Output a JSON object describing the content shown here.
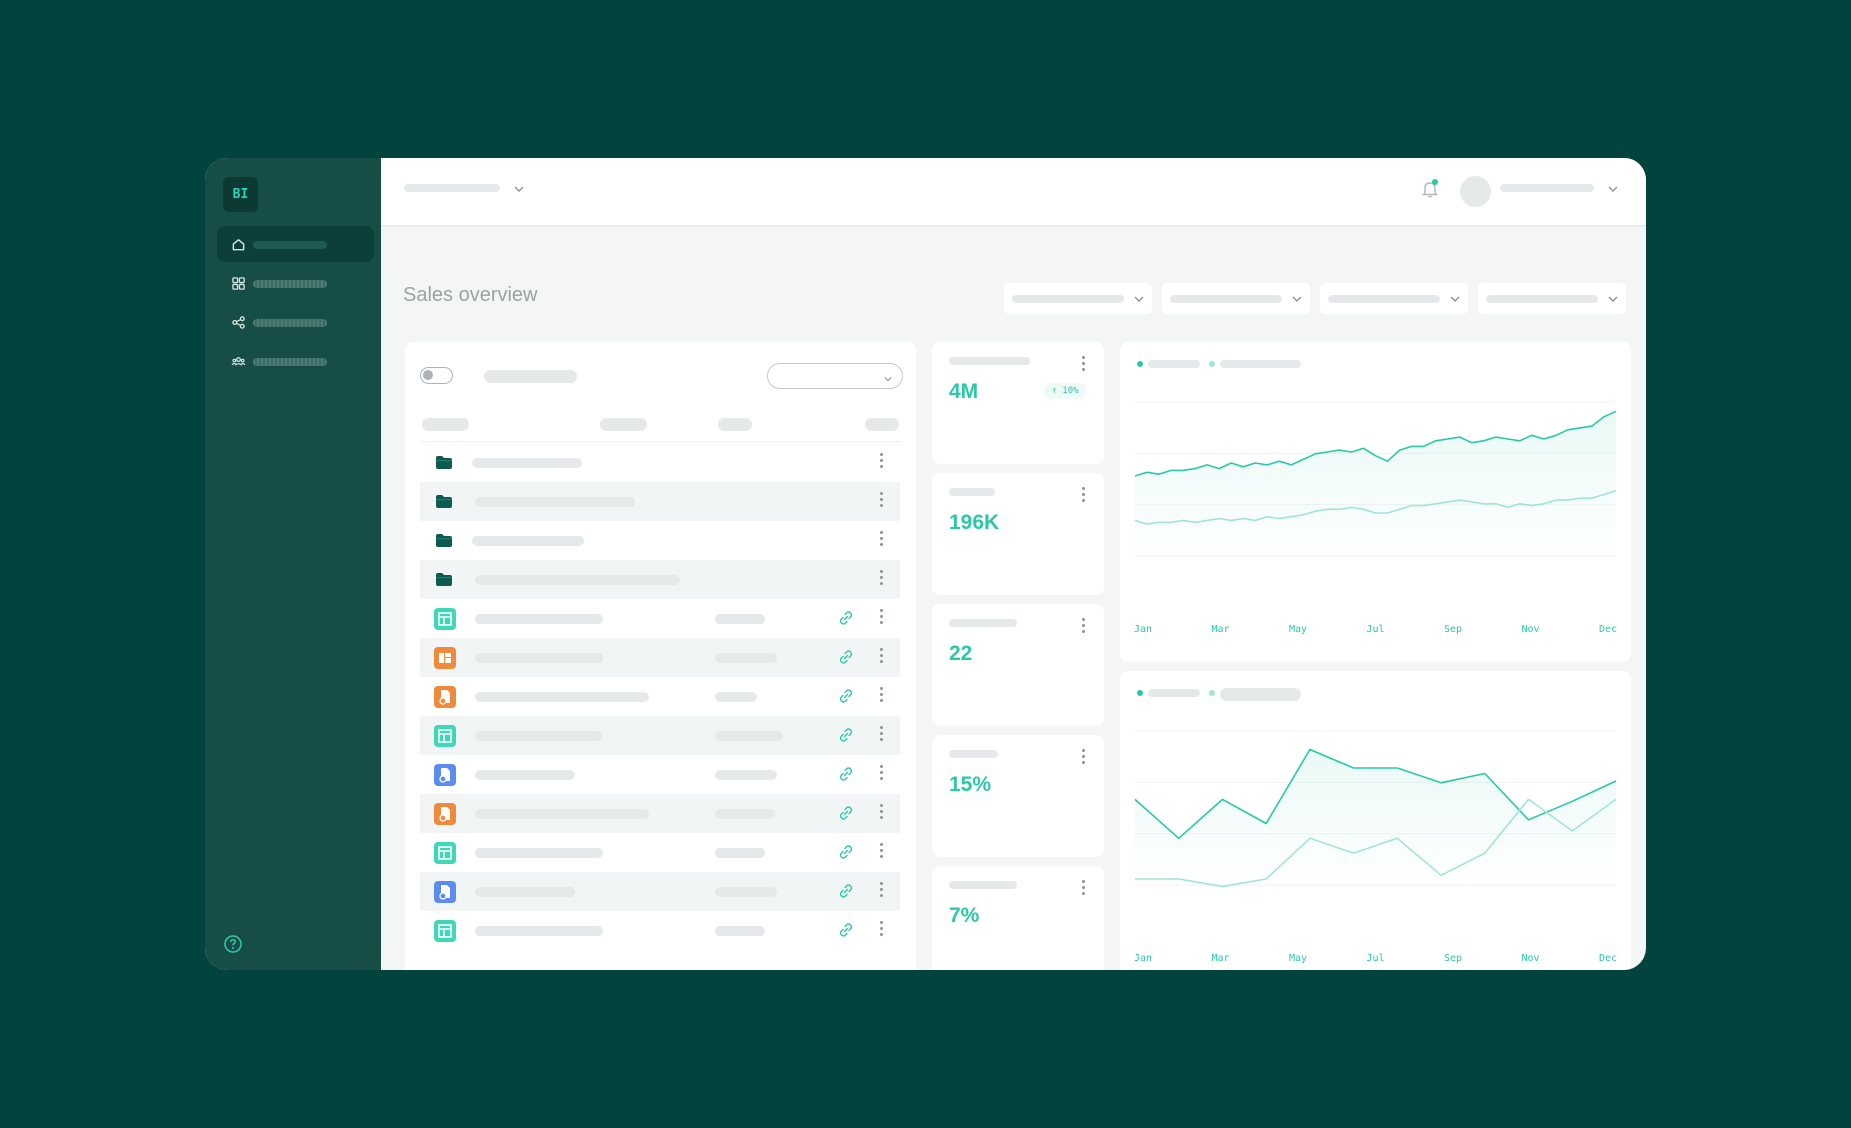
{
  "app": {
    "logo_text": "BI",
    "accent": "#29c8a8",
    "brand_bg": "#02433d",
    "sidebar_bg": "#174d47"
  },
  "sidebar": {
    "items": [
      {
        "icon": "home-icon",
        "active": true
      },
      {
        "icon": "grid-icon",
        "active": false
      },
      {
        "icon": "share-icon",
        "active": false
      },
      {
        "icon": "users-icon",
        "active": false
      }
    ],
    "help_icon": "help-icon"
  },
  "page": {
    "title": "Sales overview"
  },
  "kpis": [
    {
      "value": "4M",
      "badge": "↑ 10%"
    },
    {
      "value": "196K"
    },
    {
      "value": "22"
    },
    {
      "value": "15%"
    },
    {
      "value": "7%"
    }
  ],
  "file_list": {
    "rows": [
      {
        "type": "folder"
      },
      {
        "type": "folder"
      },
      {
        "type": "folder"
      },
      {
        "type": "folder"
      },
      {
        "type": "table",
        "color": "#3fd7b8"
      },
      {
        "type": "dashboard",
        "color": "#ef8a3c"
      },
      {
        "type": "report",
        "color": "#ef8a3c"
      },
      {
        "type": "table",
        "color": "#3fd7b8"
      },
      {
        "type": "report",
        "color": "#5b8cf0"
      },
      {
        "type": "report",
        "color": "#ef8a3c"
      },
      {
        "type": "table",
        "color": "#3fd7b8"
      },
      {
        "type": "report",
        "color": "#5b8cf0"
      },
      {
        "type": "table",
        "color": "#3fd7b8"
      }
    ]
  },
  "chart_data": [
    {
      "type": "area",
      "categories": [
        "Jan",
        "Mar",
        "May",
        "Jul",
        "Sep",
        "Nov",
        "Dec"
      ],
      "x_labels": [
        "Jan",
        "Mar",
        "May",
        "Jul",
        "Sep",
        "Nov",
        "Dec"
      ],
      "series": [
        {
          "values": [
            60,
            62,
            61,
            63,
            63,
            64,
            66,
            64,
            67,
            65,
            67,
            66,
            68,
            66,
            69,
            72,
            73,
            74,
            73,
            75,
            71,
            68,
            74,
            76,
            76,
            79,
            80,
            81,
            78,
            79,
            81,
            80,
            79,
            82,
            80,
            82,
            85,
            86,
            87,
            92,
            95
          ]
        },
        {
          "values": [
            36,
            34,
            35,
            35,
            36,
            35,
            36,
            37,
            36,
            37,
            36,
            38,
            37,
            38,
            39,
            41,
            42,
            42,
            43,
            42,
            40,
            40,
            42,
            44,
            44,
            45,
            46,
            47,
            46,
            45,
            45,
            43,
            45,
            44,
            45,
            47,
            47,
            48,
            48,
            50,
            52
          ]
        }
      ]
    },
    {
      "type": "line",
      "categories": [
        "Jan",
        "Mar",
        "May",
        "Jul",
        "Sep",
        "Nov",
        "Dec"
      ],
      "x_labels": [
        "Jan",
        "Mar",
        "May",
        "Jul",
        "Sep",
        "Nov",
        "Dec"
      ],
      "series": [
        {
          "values": [
            63,
            42,
            63,
            50,
            90,
            80,
            80,
            72,
            77,
            52,
            62,
            73
          ]
        },
        {
          "values": [
            20,
            20,
            16,
            20,
            42,
            34,
            42,
            22,
            34,
            63,
            46,
            63
          ]
        }
      ]
    }
  ]
}
